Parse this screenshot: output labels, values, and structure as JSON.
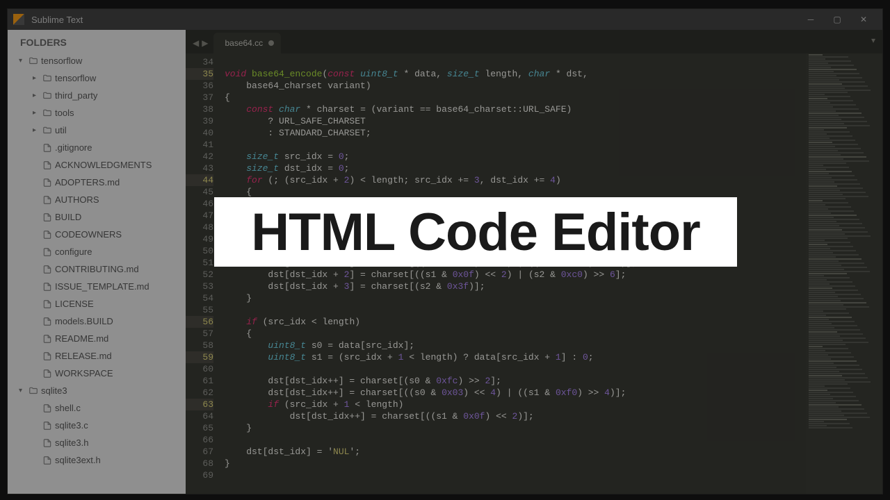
{
  "window": {
    "title": "Sublime Text"
  },
  "sidebar": {
    "header": "FOLDERS",
    "tree": [
      {
        "depth": 0,
        "kind": "folder",
        "expanded": true,
        "label": "tensorflow"
      },
      {
        "depth": 1,
        "kind": "folder",
        "expanded": false,
        "label": "tensorflow"
      },
      {
        "depth": 1,
        "kind": "folder",
        "expanded": false,
        "label": "third_party"
      },
      {
        "depth": 1,
        "kind": "folder",
        "expanded": false,
        "label": "tools"
      },
      {
        "depth": 1,
        "kind": "folder",
        "expanded": false,
        "label": "util"
      },
      {
        "depth": 1,
        "kind": "file",
        "label": ".gitignore"
      },
      {
        "depth": 1,
        "kind": "file",
        "label": "ACKNOWLEDGMENTS"
      },
      {
        "depth": 1,
        "kind": "file",
        "label": "ADOPTERS.md"
      },
      {
        "depth": 1,
        "kind": "file",
        "label": "AUTHORS"
      },
      {
        "depth": 1,
        "kind": "file",
        "label": "BUILD"
      },
      {
        "depth": 1,
        "kind": "file",
        "label": "CODEOWNERS"
      },
      {
        "depth": 1,
        "kind": "file",
        "label": "configure"
      },
      {
        "depth": 1,
        "kind": "file",
        "label": "CONTRIBUTING.md"
      },
      {
        "depth": 1,
        "kind": "file",
        "label": "ISSUE_TEMPLATE.md"
      },
      {
        "depth": 1,
        "kind": "file",
        "label": "LICENSE"
      },
      {
        "depth": 1,
        "kind": "file",
        "label": "models.BUILD"
      },
      {
        "depth": 1,
        "kind": "file",
        "label": "README.md"
      },
      {
        "depth": 1,
        "kind": "file",
        "label": "RELEASE.md"
      },
      {
        "depth": 1,
        "kind": "file",
        "label": "WORKSPACE"
      },
      {
        "depth": 0,
        "kind": "folder",
        "expanded": true,
        "label": "sqlite3"
      },
      {
        "depth": 1,
        "kind": "file",
        "label": "shell.c"
      },
      {
        "depth": 1,
        "kind": "file",
        "label": "sqlite3.c"
      },
      {
        "depth": 1,
        "kind": "file",
        "label": "sqlite3.h"
      },
      {
        "depth": 1,
        "kind": "file",
        "label": "sqlite3ext.h"
      }
    ]
  },
  "tabs": {
    "active": {
      "label": "base64.cc",
      "dirty": true
    }
  },
  "editor": {
    "first_line_no": 34,
    "highlighted_lines": [
      35,
      44,
      56,
      59,
      63
    ],
    "lines": [
      {
        "n": 34,
        "tokens": []
      },
      {
        "n": 35,
        "tokens": [
          [
            "kw",
            "void "
          ],
          [
            "fn",
            "base64_encode"
          ],
          [
            "op",
            "("
          ],
          [
            "kw",
            "const "
          ],
          [
            "ty",
            "uint8_t"
          ],
          [
            "op",
            " * data, "
          ],
          [
            "ty",
            "size_t"
          ],
          [
            "op",
            " length, "
          ],
          [
            "ty",
            "char"
          ],
          [
            "op",
            " * dst,"
          ]
        ]
      },
      {
        "n": 36,
        "tokens": [
          [
            "op",
            "    base64_charset variant)"
          ]
        ]
      },
      {
        "n": 37,
        "tokens": [
          [
            "op",
            "{"
          ]
        ]
      },
      {
        "n": 38,
        "tokens": [
          [
            "op",
            "    "
          ],
          [
            "kw",
            "const "
          ],
          [
            "ty",
            "char"
          ],
          [
            "op",
            " * charset = (variant == base64_charset::URL_SAFE)"
          ]
        ]
      },
      {
        "n": 39,
        "tokens": [
          [
            "op",
            "        ? URL_SAFE_CHARSET"
          ]
        ]
      },
      {
        "n": 40,
        "tokens": [
          [
            "op",
            "        : STANDARD_CHARSET;"
          ]
        ]
      },
      {
        "n": 41,
        "tokens": []
      },
      {
        "n": 42,
        "tokens": [
          [
            "op",
            "    "
          ],
          [
            "ty",
            "size_t"
          ],
          [
            "op",
            " src_idx = "
          ],
          [
            "nm",
            "0"
          ],
          [
            "op",
            ";"
          ]
        ]
      },
      {
        "n": 43,
        "tokens": [
          [
            "op",
            "    "
          ],
          [
            "ty",
            "size_t"
          ],
          [
            "op",
            " dst_idx = "
          ],
          [
            "nm",
            "0"
          ],
          [
            "op",
            ";"
          ]
        ]
      },
      {
        "n": 44,
        "tokens": [
          [
            "op",
            "    "
          ],
          [
            "kw",
            "for"
          ],
          [
            "op",
            " (; (src_idx + "
          ],
          [
            "nm",
            "2"
          ],
          [
            "op",
            ") < length; src_idx += "
          ],
          [
            "nm",
            "3"
          ],
          [
            "op",
            ", dst_idx += "
          ],
          [
            "nm",
            "4"
          ],
          [
            "op",
            ")"
          ]
        ]
      },
      {
        "n": 45,
        "tokens": [
          [
            "op",
            "    {"
          ]
        ]
      },
      {
        "n": 46,
        "tokens": []
      },
      {
        "n": 47,
        "tokens": []
      },
      {
        "n": 48,
        "tokens": []
      },
      {
        "n": 49,
        "tokens": []
      },
      {
        "n": 50,
        "tokens": []
      },
      {
        "n": 51,
        "tokens": [
          [
            "op",
            "        dst[dst_idx + "
          ],
          [
            "nm",
            "1"
          ],
          [
            "op",
            "] = charset[((s0 & "
          ],
          [
            "nm",
            "0x03"
          ],
          [
            "op",
            ") << "
          ],
          [
            "nm",
            "4"
          ],
          [
            "op",
            ") | ((s1 & "
          ],
          [
            "nm",
            "0xf0"
          ],
          [
            "op",
            ") >> "
          ],
          [
            "nm",
            "4"
          ],
          [
            "op",
            ")];"
          ]
        ]
      },
      {
        "n": 52,
        "tokens": [
          [
            "op",
            "        dst[dst_idx + "
          ],
          [
            "nm",
            "2"
          ],
          [
            "op",
            "] = charset[((s1 & "
          ],
          [
            "nm",
            "0x0f"
          ],
          [
            "op",
            ") << "
          ],
          [
            "nm",
            "2"
          ],
          [
            "op",
            ") | (s2 & "
          ],
          [
            "nm",
            "0xc0"
          ],
          [
            "op",
            ") >> "
          ],
          [
            "nm",
            "6"
          ],
          [
            "op",
            "];"
          ]
        ]
      },
      {
        "n": 53,
        "tokens": [
          [
            "op",
            "        dst[dst_idx + "
          ],
          [
            "nm",
            "3"
          ],
          [
            "op",
            "] = charset[(s2 & "
          ],
          [
            "nm",
            "0x3f"
          ],
          [
            "op",
            ")];"
          ]
        ]
      },
      {
        "n": 54,
        "tokens": [
          [
            "op",
            "    }"
          ]
        ]
      },
      {
        "n": 55,
        "tokens": []
      },
      {
        "n": 56,
        "tokens": [
          [
            "op",
            "    "
          ],
          [
            "kw",
            "if"
          ],
          [
            "op",
            " (src_idx < length)"
          ]
        ]
      },
      {
        "n": 57,
        "tokens": [
          [
            "op",
            "    {"
          ]
        ]
      },
      {
        "n": 58,
        "tokens": [
          [
            "op",
            "        "
          ],
          [
            "ty",
            "uint8_t"
          ],
          [
            "op",
            " s0 = data[src_idx];"
          ]
        ]
      },
      {
        "n": 59,
        "tokens": [
          [
            "op",
            "        "
          ],
          [
            "ty",
            "uint8_t"
          ],
          [
            "op",
            " s1 = (src_idx + "
          ],
          [
            "nm",
            "1"
          ],
          [
            "op",
            " < length) ? data[src_idx + "
          ],
          [
            "nm",
            "1"
          ],
          [
            "op",
            "] : "
          ],
          [
            "nm",
            "0"
          ],
          [
            "op",
            ";"
          ]
        ]
      },
      {
        "n": 60,
        "tokens": []
      },
      {
        "n": 61,
        "tokens": [
          [
            "op",
            "        dst[dst_idx++] = charset[(s0 & "
          ],
          [
            "nm",
            "0xfc"
          ],
          [
            "op",
            ") >> "
          ],
          [
            "nm",
            "2"
          ],
          [
            "op",
            "];"
          ]
        ]
      },
      {
        "n": 62,
        "tokens": [
          [
            "op",
            "        dst[dst_idx++] = charset[((s0 & "
          ],
          [
            "nm",
            "0x03"
          ],
          [
            "op",
            ") << "
          ],
          [
            "nm",
            "4"
          ],
          [
            "op",
            ") | ((s1 & "
          ],
          [
            "nm",
            "0xf0"
          ],
          [
            "op",
            ") >> "
          ],
          [
            "nm",
            "4"
          ],
          [
            "op",
            ")];"
          ]
        ]
      },
      {
        "n": 63,
        "tokens": [
          [
            "op",
            "        "
          ],
          [
            "kw",
            "if"
          ],
          [
            "op",
            " (src_idx + "
          ],
          [
            "nm",
            "1"
          ],
          [
            "op",
            " < length)"
          ]
        ]
      },
      {
        "n": 64,
        "tokens": [
          [
            "op",
            "            dst[dst_idx++] = charset[((s1 & "
          ],
          [
            "nm",
            "0x0f"
          ],
          [
            "op",
            ") << "
          ],
          [
            "nm",
            "2"
          ],
          [
            "op",
            ")];"
          ]
        ]
      },
      {
        "n": 65,
        "tokens": [
          [
            "op",
            "    }"
          ]
        ]
      },
      {
        "n": 66,
        "tokens": []
      },
      {
        "n": 67,
        "tokens": [
          [
            "op",
            "    dst[dst_idx] = '"
          ],
          [
            "st",
            "NUL"
          ],
          [
            "op",
            "';"
          ]
        ]
      },
      {
        "n": 68,
        "tokens": [
          [
            "op",
            "}"
          ]
        ]
      },
      {
        "n": 69,
        "tokens": []
      }
    ]
  },
  "overlay": {
    "text": "HTML Code Editor"
  }
}
